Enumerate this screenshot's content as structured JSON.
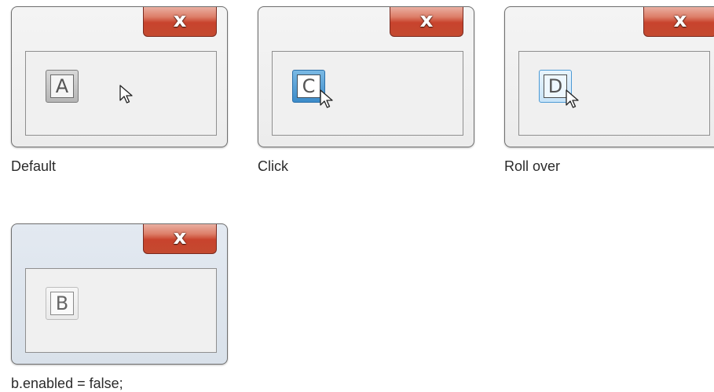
{
  "panels": [
    {
      "state": "default",
      "caption": "Default",
      "button_letter": "A",
      "close_label": "x"
    },
    {
      "state": "click",
      "caption": "Click",
      "button_letter": "C",
      "close_label": "x"
    },
    {
      "state": "rollover",
      "caption": "Roll over",
      "button_letter": "D",
      "close_label": "x"
    },
    {
      "state": "disabled",
      "caption": "b.enabled = false;",
      "button_letter": "B",
      "close_label": "x"
    }
  ],
  "icons": {
    "close": "close-icon",
    "cursor": "arrow-cursor-icon"
  },
  "colors": {
    "close_button": "#c8432d",
    "click_accent": "#3c8bc9",
    "rollover_accent": "#c7e3f8",
    "disabled_window": "#dde4ec"
  }
}
